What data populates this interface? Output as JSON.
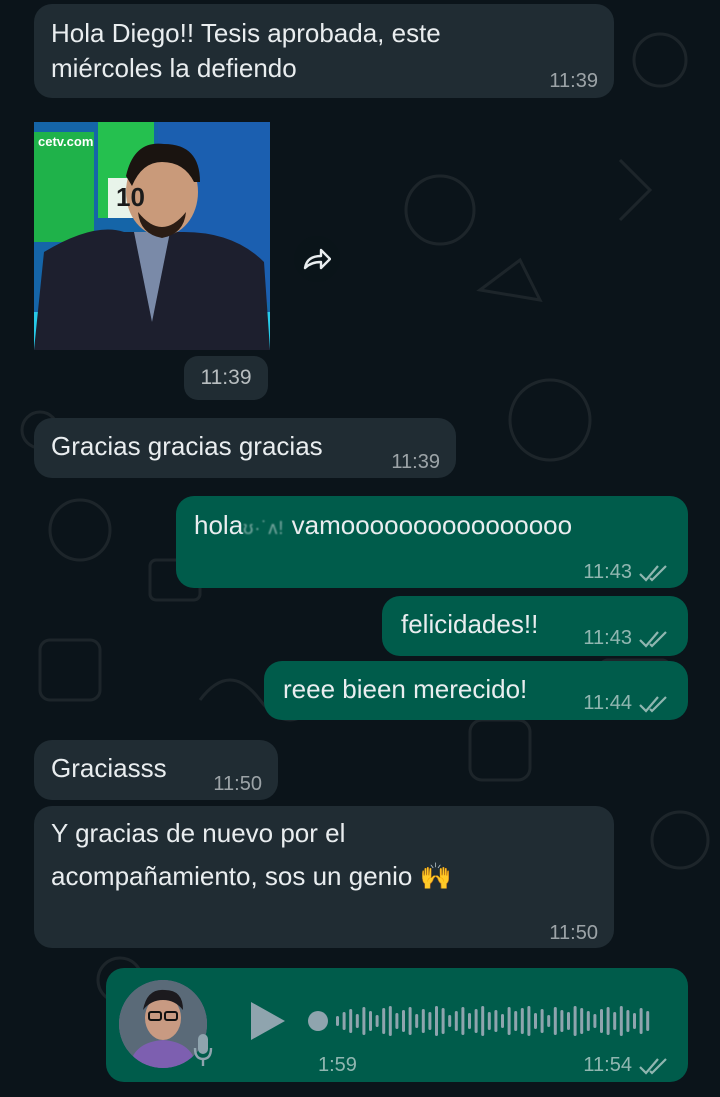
{
  "messages": {
    "m1": {
      "text_line1": "Hola Diego!! Tesis aprobada, este",
      "text_line2": "miércoles la defiendo",
      "time": "11:39"
    },
    "m2": {
      "image_logo": "cetv.com",
      "image_number": "10",
      "time": "11:39"
    },
    "m3": {
      "text": "Gracias gracias gracias",
      "time": "11:39"
    },
    "m4": {
      "text_prefix": "hola",
      "text_blurred": "ʊ·˙ᴧ!",
      "text_suffix": " vamoooooooooooooooo",
      "time": "11:43"
    },
    "m5": {
      "text": "felicidades!!",
      "time": "11:43"
    },
    "m6": {
      "text": "reee bieen merecido!",
      "time": "11:44"
    },
    "m7": {
      "text": "Graciasss",
      "time": "11:50"
    },
    "m8": {
      "text_line1": "Y gracias de nuevo por el",
      "text_line2": "acompañamiento, sos un genio 🙌",
      "time": "11:50"
    },
    "m9": {
      "duration": "1:59",
      "time": "11:54"
    }
  },
  "colors": {
    "background": "#0b141a",
    "incoming_bubble": "#202c33",
    "outgoing_bubble": "#005c4b",
    "text": "#e9edef"
  },
  "icons": {
    "forward": "forward-arrow-icon",
    "read_receipt": "double-check-icon",
    "play": "play-icon",
    "mic": "mic-icon"
  }
}
